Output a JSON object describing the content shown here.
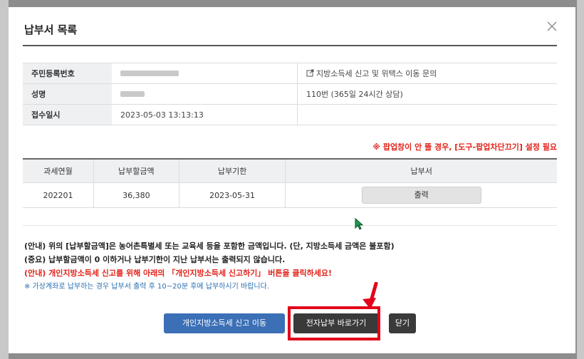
{
  "modal": {
    "title": "납부서 목록"
  },
  "info": {
    "rows": [
      {
        "label": "주민등록번호",
        "value": "",
        "note": "지방소득세 신고 및 위택스 이동 문의"
      },
      {
        "label": "성명",
        "value": "",
        "note": "110번 (365일 24시간 상담)"
      },
      {
        "label": "접수일시",
        "value": "2023-05-03 13:13:13",
        "note": ""
      }
    ],
    "note_icon": "external-link-icon"
  },
  "popup_warning": "※ 팝업창이 안 뜰 경우, [도구-팝업차단끄기] 설정 필요",
  "payment_table": {
    "headers": [
      "과세연월",
      "납부할금액",
      "납부기한",
      "납부서"
    ],
    "rows": [
      {
        "period": "202201",
        "amount": "36,380",
        "due": "2023-05-31",
        "action": "출력"
      }
    ]
  },
  "notices": [
    "(안내) 위의 [납부할금액]은 농어촌특별세 또는 교육세 등을 포함한 금액입니다. (단, 지방소득세 금액은 불포함)",
    "(중요) 납부할금액이 0 이하거나 납부기한이 지난 납부서는 출력되지 않습니다.",
    "(안내) 개인지방소득세 신고를 위해 아래의 「개인지방소득세 신고하기」 버튼을 클릭하세요!",
    "※ 가상계좌로 납부하는 경우 납부서 출력 후 10~20분 후에 납부하시기 바랍니다."
  ],
  "buttons": {
    "local_tax": "개인지방소득세 신고 이동",
    "e_payment": "전자납부 바로가기",
    "close": "닫기"
  },
  "colors": {
    "accent_red": "#e2231a",
    "button_blue": "#3b6fb6",
    "button_dark": "#3a3a3a"
  }
}
